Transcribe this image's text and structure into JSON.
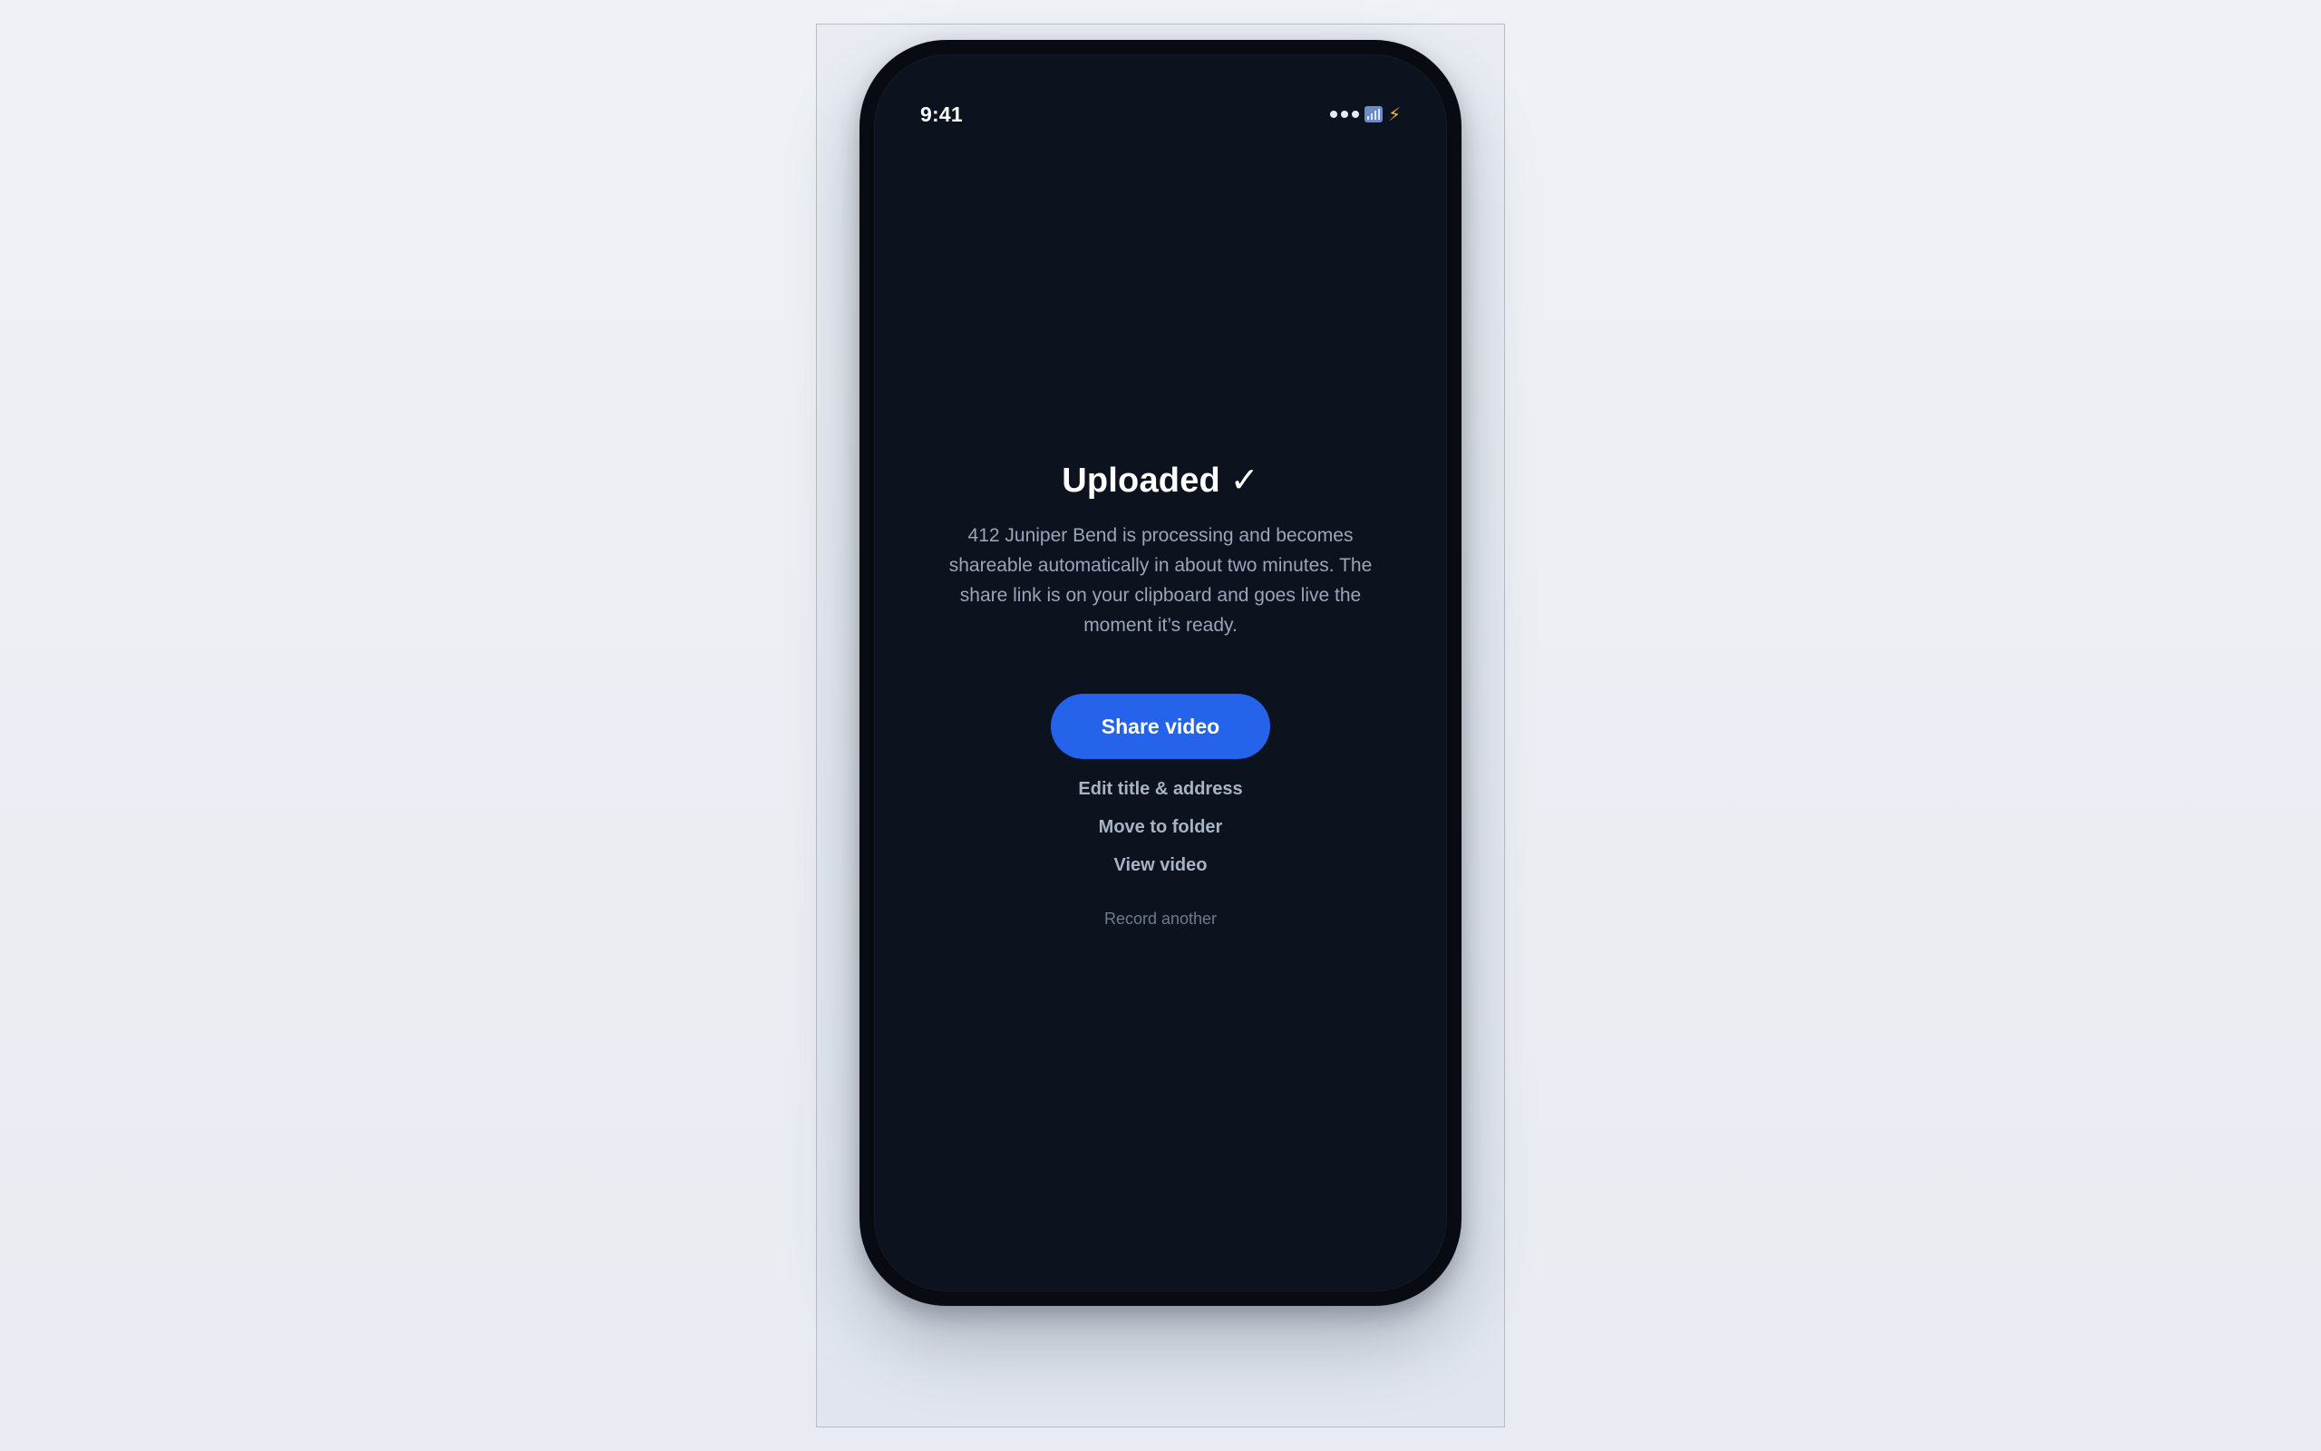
{
  "status_bar": {
    "time": "9:41",
    "icons": [
      "signal-dots-icon",
      "wifi-icon",
      "battery-charging-icon"
    ]
  },
  "upload": {
    "title": "Uploaded",
    "title_check": "✓",
    "description": "412 Juniper Bend is processing and becomes shareable automatically in about two minutes. The share link is on your clipboard and goes live the moment it’s ready.",
    "primary_action": "Share video",
    "actions": [
      "Edit title & address",
      "Move to folder",
      "View video"
    ],
    "secondary_action": "Record another"
  },
  "colors": {
    "background": "#0c121e",
    "accent": "#2563eb",
    "text_primary": "#ffffff",
    "text_secondary": "#9aa5b8"
  }
}
